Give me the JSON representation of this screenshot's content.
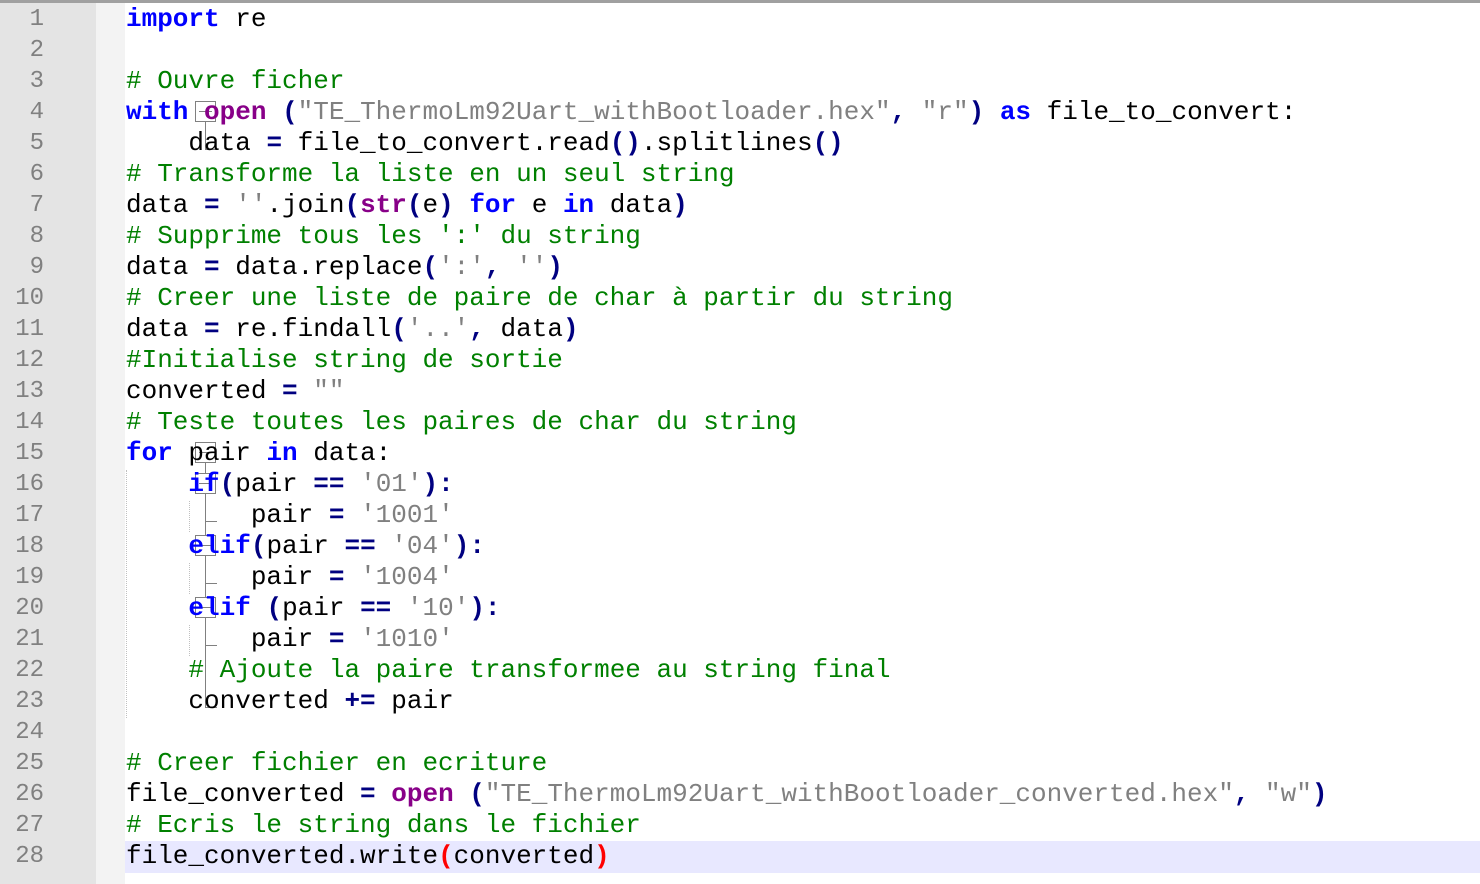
{
  "editor": {
    "lines": [
      {
        "number": "1",
        "tokens": [
          {
            "t": "import",
            "c": "kw"
          },
          {
            "t": " re",
            "c": "plain"
          }
        ]
      },
      {
        "number": "2",
        "tokens": []
      },
      {
        "number": "3",
        "tokens": [
          {
            "t": "# Ouvre ficher",
            "c": "com"
          }
        ]
      },
      {
        "number": "4",
        "tokens": [
          {
            "t": "with",
            "c": "kw"
          },
          {
            "t": " ",
            "c": "plain"
          },
          {
            "t": "open",
            "c": "kw2"
          },
          {
            "t": " ",
            "c": "plain"
          },
          {
            "t": "(",
            "c": "op"
          },
          {
            "t": "\"TE_ThermoLm92Uart_withBootloader.hex\"",
            "c": "str"
          },
          {
            "t": ", ",
            "c": "op"
          },
          {
            "t": "\"r\"",
            "c": "str"
          },
          {
            "t": ")",
            "c": "op"
          },
          {
            "t": " ",
            "c": "plain"
          },
          {
            "t": "as",
            "c": "kw"
          },
          {
            "t": " file_to_convert:",
            "c": "plain"
          }
        ]
      },
      {
        "number": "5",
        "tokens": [
          {
            "t": "    data ",
            "c": "plain"
          },
          {
            "t": "=",
            "c": "op"
          },
          {
            "t": " file_to_convert.read",
            "c": "plain"
          },
          {
            "t": "()",
            "c": "op"
          },
          {
            "t": ".splitlines",
            "c": "plain"
          },
          {
            "t": "()",
            "c": "op"
          }
        ]
      },
      {
        "number": "6",
        "tokens": [
          {
            "t": "# Transforme la liste en un seul string",
            "c": "com"
          }
        ]
      },
      {
        "number": "7",
        "tokens": [
          {
            "t": "data ",
            "c": "plain"
          },
          {
            "t": "=",
            "c": "op"
          },
          {
            "t": " ",
            "c": "plain"
          },
          {
            "t": "''",
            "c": "str"
          },
          {
            "t": ".join",
            "c": "plain"
          },
          {
            "t": "(",
            "c": "op"
          },
          {
            "t": "str",
            "c": "kw2"
          },
          {
            "t": "(",
            "c": "op"
          },
          {
            "t": "e",
            "c": "plain"
          },
          {
            "t": ")",
            "c": "op"
          },
          {
            "t": " ",
            "c": "plain"
          },
          {
            "t": "for",
            "c": "kw"
          },
          {
            "t": " e ",
            "c": "plain"
          },
          {
            "t": "in",
            "c": "kw"
          },
          {
            "t": " data",
            "c": "plain"
          },
          {
            "t": ")",
            "c": "op"
          }
        ]
      },
      {
        "number": "8",
        "tokens": [
          {
            "t": "# Supprime tous les ':' du string",
            "c": "com"
          }
        ]
      },
      {
        "number": "9",
        "tokens": [
          {
            "t": "data ",
            "c": "plain"
          },
          {
            "t": "=",
            "c": "op"
          },
          {
            "t": " data.replace",
            "c": "plain"
          },
          {
            "t": "(",
            "c": "op"
          },
          {
            "t": "':'",
            "c": "str"
          },
          {
            "t": ", ",
            "c": "op"
          },
          {
            "t": "''",
            "c": "str"
          },
          {
            "t": ")",
            "c": "op"
          }
        ]
      },
      {
        "number": "10",
        "tokens": [
          {
            "t": "# Creer une liste de paire de char à partir du string",
            "c": "com"
          }
        ]
      },
      {
        "number": "11",
        "tokens": [
          {
            "t": "data ",
            "c": "plain"
          },
          {
            "t": "=",
            "c": "op"
          },
          {
            "t": " re.findall",
            "c": "plain"
          },
          {
            "t": "(",
            "c": "op"
          },
          {
            "t": "'..'",
            "c": "str"
          },
          {
            "t": ", ",
            "c": "op"
          },
          {
            "t": "data",
            "c": "plain"
          },
          {
            "t": ")",
            "c": "op"
          }
        ]
      },
      {
        "number": "12",
        "tokens": [
          {
            "t": "#Initialise string de sortie",
            "c": "com"
          }
        ]
      },
      {
        "number": "13",
        "tokens": [
          {
            "t": "converted ",
            "c": "plain"
          },
          {
            "t": "=",
            "c": "op"
          },
          {
            "t": " ",
            "c": "plain"
          },
          {
            "t": "\"\"",
            "c": "str"
          }
        ]
      },
      {
        "number": "14",
        "tokens": [
          {
            "t": "# Teste toutes les paires de char du string",
            "c": "com"
          }
        ]
      },
      {
        "number": "15",
        "tokens": [
          {
            "t": "for",
            "c": "kw"
          },
          {
            "t": " pair ",
            "c": "plain"
          },
          {
            "t": "in",
            "c": "kw"
          },
          {
            "t": " data:",
            "c": "plain"
          }
        ]
      },
      {
        "number": "16",
        "tokens": [
          {
            "t": "    ",
            "c": "plain"
          },
          {
            "t": "if",
            "c": "kw"
          },
          {
            "t": "(",
            "c": "op"
          },
          {
            "t": "pair ",
            "c": "plain"
          },
          {
            "t": "==",
            "c": "op"
          },
          {
            "t": " ",
            "c": "plain"
          },
          {
            "t": "'01'",
            "c": "str"
          },
          {
            "t": "):",
            "c": "op"
          }
        ]
      },
      {
        "number": "17",
        "tokens": [
          {
            "t": "        pair ",
            "c": "plain"
          },
          {
            "t": "=",
            "c": "op"
          },
          {
            "t": " ",
            "c": "plain"
          },
          {
            "t": "'1001'",
            "c": "str"
          }
        ]
      },
      {
        "number": "18",
        "tokens": [
          {
            "t": "    ",
            "c": "plain"
          },
          {
            "t": "elif",
            "c": "kw"
          },
          {
            "t": "(",
            "c": "op"
          },
          {
            "t": "pair ",
            "c": "plain"
          },
          {
            "t": "==",
            "c": "op"
          },
          {
            "t": " ",
            "c": "plain"
          },
          {
            "t": "'04'",
            "c": "str"
          },
          {
            "t": "):",
            "c": "op"
          }
        ]
      },
      {
        "number": "19",
        "tokens": [
          {
            "t": "        pair ",
            "c": "plain"
          },
          {
            "t": "=",
            "c": "op"
          },
          {
            "t": " ",
            "c": "plain"
          },
          {
            "t": "'1004'",
            "c": "str"
          }
        ]
      },
      {
        "number": "20",
        "tokens": [
          {
            "t": "    ",
            "c": "plain"
          },
          {
            "t": "elif",
            "c": "kw"
          },
          {
            "t": " ",
            "c": "plain"
          },
          {
            "t": "(",
            "c": "op"
          },
          {
            "t": "pair ",
            "c": "plain"
          },
          {
            "t": "==",
            "c": "op"
          },
          {
            "t": " ",
            "c": "plain"
          },
          {
            "t": "'10'",
            "c": "str"
          },
          {
            "t": "):",
            "c": "op"
          }
        ]
      },
      {
        "number": "21",
        "tokens": [
          {
            "t": "        pair ",
            "c": "plain"
          },
          {
            "t": "=",
            "c": "op"
          },
          {
            "t": " ",
            "c": "plain"
          },
          {
            "t": "'1010'",
            "c": "str"
          }
        ]
      },
      {
        "number": "22",
        "tokens": [
          {
            "t": "    ",
            "c": "plain"
          },
          {
            "t": "# Ajoute la paire transformee au string final",
            "c": "com"
          }
        ]
      },
      {
        "number": "23",
        "tokens": [
          {
            "t": "    converted ",
            "c": "plain"
          },
          {
            "t": "+=",
            "c": "op"
          },
          {
            "t": " pair",
            "c": "plain"
          }
        ]
      },
      {
        "number": "24",
        "tokens": []
      },
      {
        "number": "25",
        "tokens": [
          {
            "t": "# Creer fichier en ecriture",
            "c": "com"
          }
        ]
      },
      {
        "number": "26",
        "tokens": [
          {
            "t": "file_converted ",
            "c": "plain"
          },
          {
            "t": "=",
            "c": "op"
          },
          {
            "t": " ",
            "c": "plain"
          },
          {
            "t": "open",
            "c": "kw2"
          },
          {
            "t": " ",
            "c": "plain"
          },
          {
            "t": "(",
            "c": "op"
          },
          {
            "t": "\"TE_ThermoLm92Uart_withBootloader_converted.hex\"",
            "c": "str"
          },
          {
            "t": ", ",
            "c": "op"
          },
          {
            "t": "\"w\"",
            "c": "str"
          },
          {
            "t": ")",
            "c": "op"
          }
        ]
      },
      {
        "number": "27",
        "tokens": [
          {
            "t": "# Ecris le string dans le fichier",
            "c": "com"
          }
        ]
      },
      {
        "number": "28",
        "tokens": [
          {
            "t": "file_converted.write",
            "c": "plain"
          },
          {
            "t": "(",
            "c": "brace"
          },
          {
            "t": "converted",
            "c": "plain"
          },
          {
            "t": ")",
            "c": "brace"
          }
        ]
      }
    ]
  }
}
